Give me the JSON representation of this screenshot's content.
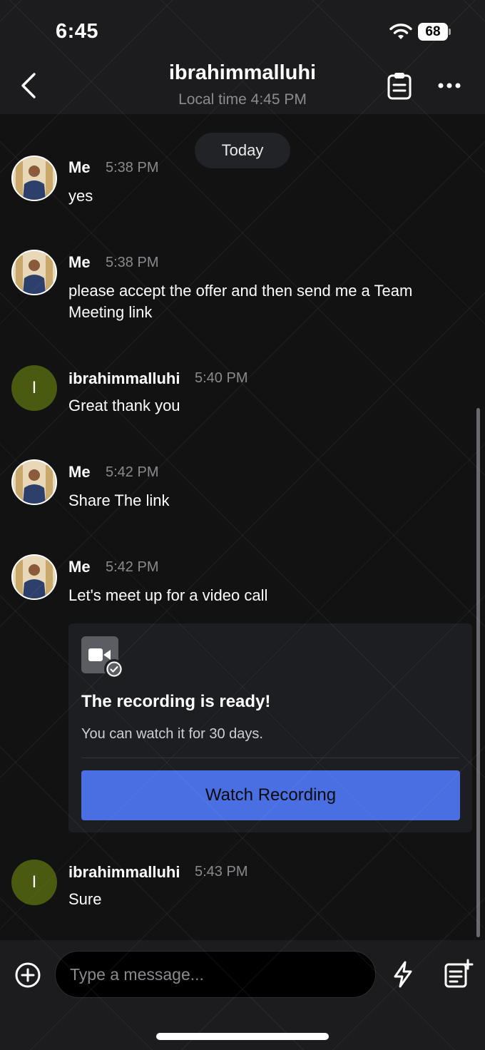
{
  "status_bar": {
    "time": "6:45",
    "battery": "68"
  },
  "header": {
    "title": "ibrahimmalluhi",
    "subtitle": "Local time 4:45 PM"
  },
  "date_separator": "Today",
  "messages": [
    {
      "sender": "Me",
      "time": "5:38 PM",
      "text": "yes",
      "avatar": "photo"
    },
    {
      "sender": "Me",
      "time": "5:38 PM",
      "text": "please accept the offer and then send me a Team Meeting link",
      "avatar": "photo"
    },
    {
      "sender": "ibrahimmalluhi",
      "time": "5:40 PM",
      "text": "Great thank you",
      "avatar": "I"
    },
    {
      "sender": "Me",
      "time": "5:42 PM",
      "text": "Share The link",
      "avatar": "photo"
    },
    {
      "sender": "Me",
      "time": "5:42 PM",
      "text": "Let's meet up for a video call",
      "avatar": "photo"
    },
    {
      "sender": "ibrahimmalluhi",
      "time": "5:43 PM",
      "text": "Sure",
      "avatar": "I"
    }
  ],
  "recording_card": {
    "title": "The recording is ready!",
    "description": "You can watch it for 30 days.",
    "button": "Watch Recording"
  },
  "composer": {
    "placeholder": "Type a message..."
  },
  "icons": {
    "back": "chevron-left-icon",
    "clipboard": "clipboard-icon",
    "more": "more-dots-icon",
    "add": "plus-circle-icon",
    "bolt": "lightning-icon",
    "note": "note-add-icon",
    "camera": "video-camera-icon",
    "check": "check-circle-icon"
  },
  "colors": {
    "accent": "#4a6fe3",
    "initial_avatar": "#4a5a10",
    "background": "#121212",
    "header": "#1c1c1e"
  }
}
